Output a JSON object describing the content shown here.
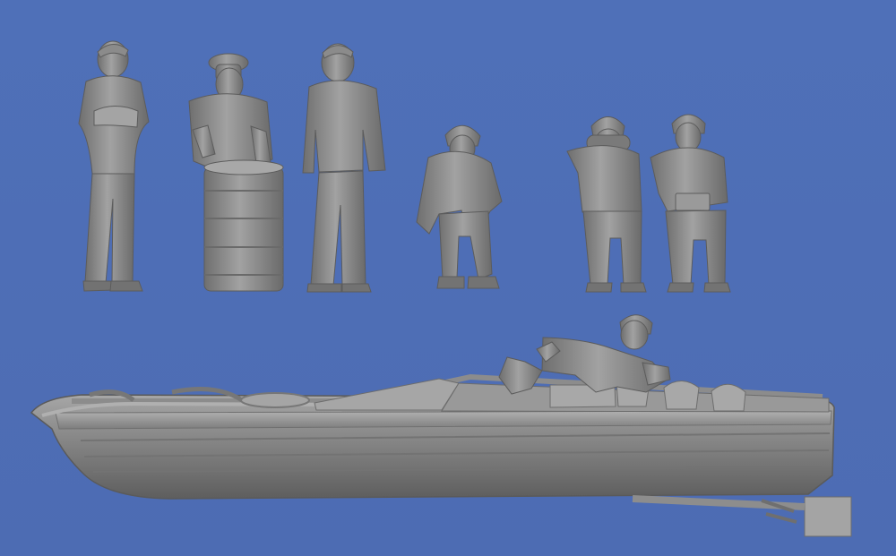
{
  "scene": {
    "background_color": "#4f6fb4",
    "model_color": "#8f8f8f",
    "subjects": [
      "standing-figure-arms-crossed",
      "standing-figure-peaked-cap-with-drum",
      "standing-figure-side-cap",
      "seated-figure-helmet",
      "seated-figure-binoculars",
      "seated-figure-with-box",
      "reclining-figure-on-boat",
      "motor-boat-hull"
    ]
  }
}
